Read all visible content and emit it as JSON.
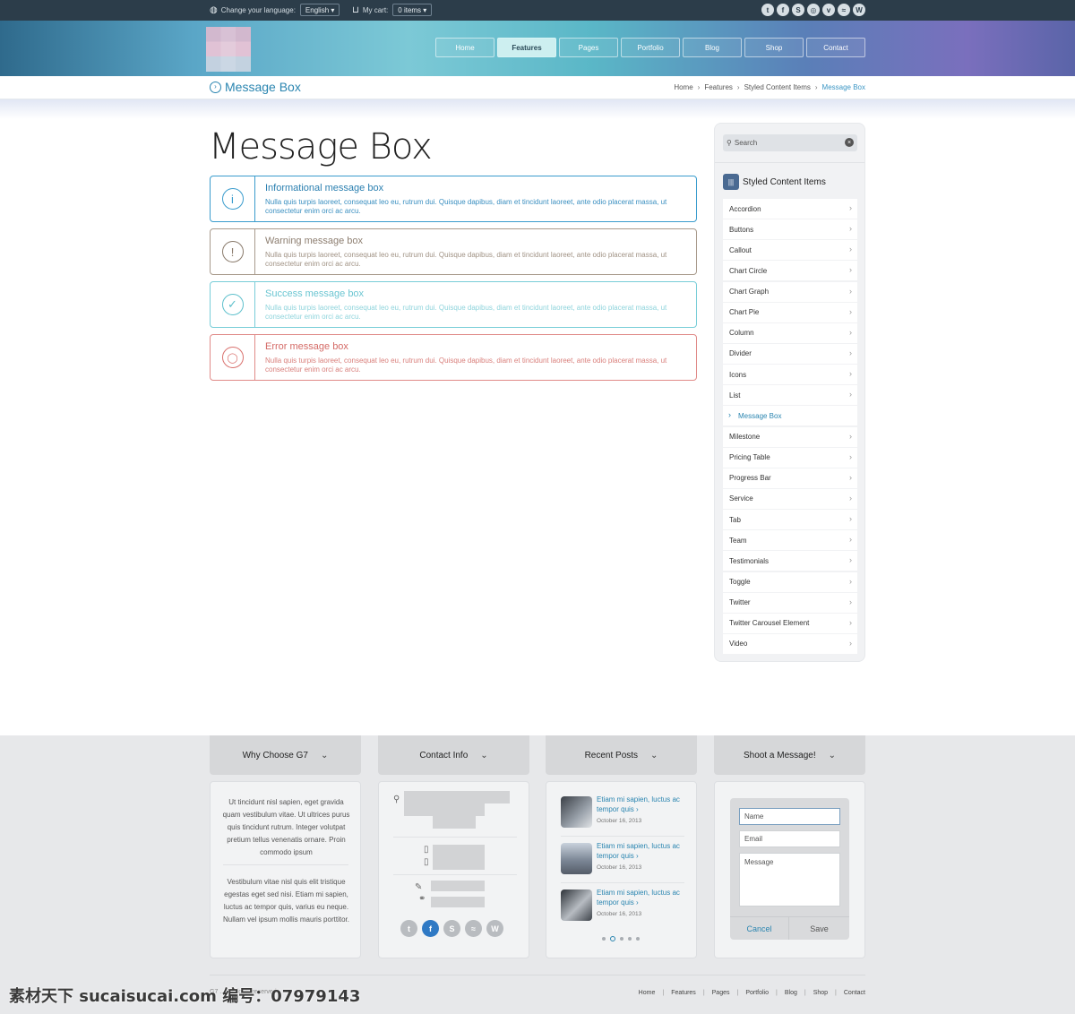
{
  "topbar": {
    "language_label": "Change your language:",
    "language_value": "English",
    "cart_label": "My cart:",
    "cart_value": "0 items",
    "social_icons": [
      "twitter-icon",
      "facebook-icon",
      "skype-icon",
      "dribbble-icon",
      "vimeo-icon",
      "rss-icon",
      "wordpress-icon"
    ]
  },
  "nav": {
    "items": [
      {
        "label": "Home"
      },
      {
        "label": "Features",
        "active": true
      },
      {
        "label": "Pages"
      },
      {
        "label": "Portfolio"
      },
      {
        "label": "Blog"
      },
      {
        "label": "Shop"
      },
      {
        "label": "Contact"
      }
    ]
  },
  "titlebar": {
    "title": "Message Box",
    "breadcrumbs": [
      "Home",
      "Features",
      "Styled Content Items",
      "Message Box"
    ]
  },
  "main": {
    "heading": "Message Box",
    "messages": [
      {
        "type": "info",
        "icon": "info-icon",
        "glyph": "i",
        "title": "Informational message box",
        "text": "Nulla quis turpis laoreet, consequat leo eu, rutrum dui. Quisque dapibus, diam et tincidunt laoreet, ante odio placerat massa, ut consectetur enim orci ac arcu."
      },
      {
        "type": "warn",
        "icon": "warning-icon",
        "glyph": "!",
        "title": "Warning message box",
        "text": "Nulla quis turpis laoreet, consequat leo eu, rutrum dui. Quisque dapibus, diam et tincidunt laoreet, ante odio placerat massa, ut consectetur enim orci ac arcu."
      },
      {
        "type": "succ",
        "icon": "check-icon",
        "glyph": "✓",
        "title": "Success message box",
        "text": "Nulla quis turpis laoreet, consequat leo eu, rutrum dui. Quisque dapibus, diam et tincidunt laoreet, ante odio placerat massa, ut consectetur enim orci ac arcu."
      },
      {
        "type": "err",
        "icon": "lightbulb-icon",
        "glyph": "💡",
        "title": "Error message box",
        "text": "Nulla quis turpis laoreet, consequat leo eu, rutrum dui. Quisque dapibus, diam et tincidunt laoreet, ante odio placerat massa, ut consectetur enim orci ac arcu."
      }
    ]
  },
  "sidebar": {
    "search_placeholder": "Search",
    "heading": "Styled Content Items",
    "items": [
      {
        "label": "Accordion"
      },
      {
        "label": "Buttons"
      },
      {
        "label": "Callout"
      },
      {
        "label": "Chart Circle"
      },
      {
        "label": "Chart Graph"
      },
      {
        "label": "Chart Pie"
      },
      {
        "label": "Column"
      },
      {
        "label": "Divider"
      },
      {
        "label": "Icons"
      },
      {
        "label": "List"
      },
      {
        "label": "Message Box",
        "active": true
      },
      {
        "label": "Milestone"
      },
      {
        "label": "Pricing Table"
      },
      {
        "label": "Progress Bar"
      },
      {
        "label": "Service"
      },
      {
        "label": "Tab"
      },
      {
        "label": "Team"
      },
      {
        "label": "Testimonials"
      },
      {
        "label": "Toggle"
      },
      {
        "label": "Twitter"
      },
      {
        "label": "Twitter Carousel Element"
      },
      {
        "label": "Video"
      }
    ]
  },
  "footer": {
    "tabs": [
      "Why Choose G7",
      "Contact Info",
      "Recent Posts",
      "Shoot a Message!"
    ],
    "why": {
      "para1": "Ut tincidunt nisl sapien, eget gravida quam vestibulum vitae. Ut ultrices purus quis tincidunt rutrum. Integer volutpat pretium tellus venenatis ornare. Proin commodo ipsum",
      "para2": "Vestibulum vitae nisl quis elit tristique egestas eget sed nisi. Etiam mi sapien, luctus ac tempor quis, varius eu neque. Nullam vel ipsum mollis mauris porttitor."
    },
    "contact_social": [
      "twitter-icon",
      "facebook-icon",
      "skype-icon",
      "rss-icon",
      "wordpress-icon"
    ],
    "posts": [
      {
        "title": "Etiam mi sapien, luctus ac tempor quis",
        "date": "October 16, 2013"
      },
      {
        "title": "Etiam mi sapien, luctus ac tempor quis",
        "date": "October 16, 2013"
      },
      {
        "title": "Etiam mi sapien, luctus ac tempor quis",
        "date": "October 16, 2013"
      }
    ],
    "form": {
      "name_placeholder": "Name",
      "email_placeholder": "Email",
      "message_placeholder": "Message",
      "cancel_label": "Cancel",
      "save_label": "Save"
    },
    "copyright": "G7 ... All rights reserved",
    "bottom_nav": [
      "Home",
      "Features",
      "Pages",
      "Portfolio",
      "Blog",
      "Shop",
      "Contact"
    ]
  },
  "watermark": "素材天下 sucaisucai.com  编号：07979143"
}
